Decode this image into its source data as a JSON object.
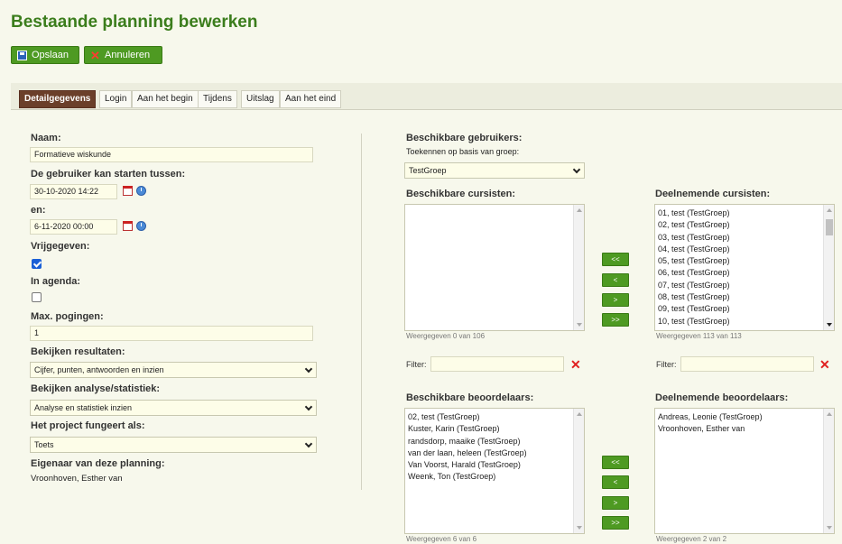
{
  "page_title": "Bestaande planning bewerken",
  "toolbar": {
    "save_label": "Opslaan",
    "cancel_label": "Annuleren"
  },
  "tabs": [
    {
      "label": "Detailgegevens",
      "active": true
    },
    {
      "label": "Login"
    },
    {
      "label": "Aan het begin"
    },
    {
      "label": "Tijdens"
    },
    {
      "label": "Uitslag"
    },
    {
      "label": "Aan het eind"
    }
  ],
  "form": {
    "naam_label": "Naam:",
    "naam_value": "Formatieve wiskunde",
    "start_label": "De gebruiker kan starten tussen:",
    "start_value": "30-10-2020 14:22",
    "end_label": "en:",
    "end_value": "6-11-2020 00:00",
    "vrijgegeven_label": "Vrijgegeven:",
    "vrijgegeven_checked": true,
    "agenda_label": "In agenda:",
    "agenda_checked": false,
    "pogingen_label": "Max. pogingen:",
    "pogingen_value": "1",
    "resultaten_label": "Bekijken resultaten:",
    "resultaten_value": "Cijfer, punten, antwoorden en inzien",
    "analyse_label": "Bekijken analyse/statistiek:",
    "analyse_value": "Analyse en statistiek inzien",
    "project_label": "Het project fungeert als:",
    "project_value": "Toets",
    "eigenaar_label": "Eigenaar van deze planning:",
    "eigenaar_value": "Vroonhoven, Esther van"
  },
  "users": {
    "available_label": "Beschikbare gebruikers:",
    "group_hint": "Toekennen op basis van groep:",
    "group_value": "TestGroep"
  },
  "students": {
    "available_label": "Beschikbare cursisten:",
    "available_items": [],
    "available_meta": "Weergegeven 0 van 106",
    "participating_label": "Deelnemende cursisten:",
    "participating_items": [
      "01, test (TestGroep)",
      "02, test (TestGroep)",
      "03, test (TestGroep)",
      "04, test (TestGroep)",
      "05, test (TestGroep)",
      "06, test (TestGroep)",
      "07, test (TestGroep)",
      "08, test (TestGroep)",
      "09, test (TestGroep)",
      "10, test (TestGroep)"
    ],
    "participating_meta": "Weergegeven 113 van 113",
    "filter_label": "Filter:",
    "filter_value": ""
  },
  "transfer_buttons": [
    "<<",
    "<",
    ">",
    ">>"
  ],
  "graders": {
    "available_label": "Beschikbare beoordelaars:",
    "available_items": [
      "02, test (TestGroep)",
      "Kuster, Karin (TestGroep)",
      "randsdorp, maaike (TestGroep)",
      "van der laan, heleen (TestGroep)",
      "Van Voorst, Harald (TestGroep)",
      "Weenk, Ton (TestGroep)"
    ],
    "available_meta": "Weergegeven 6 van 6",
    "participating_label": "Deelnemende beoordelaars:",
    "participating_items": [
      "Andreas, Leonie (TestGroep)",
      "Vroonhoven, Esther van"
    ],
    "participating_meta": "Weergegeven 2 van 2"
  },
  "colors": {
    "title_green": "#3b7d1c",
    "button_green": "#4e9a22",
    "active_tab": "#6b3f2a",
    "remove_red": "#e02020"
  }
}
